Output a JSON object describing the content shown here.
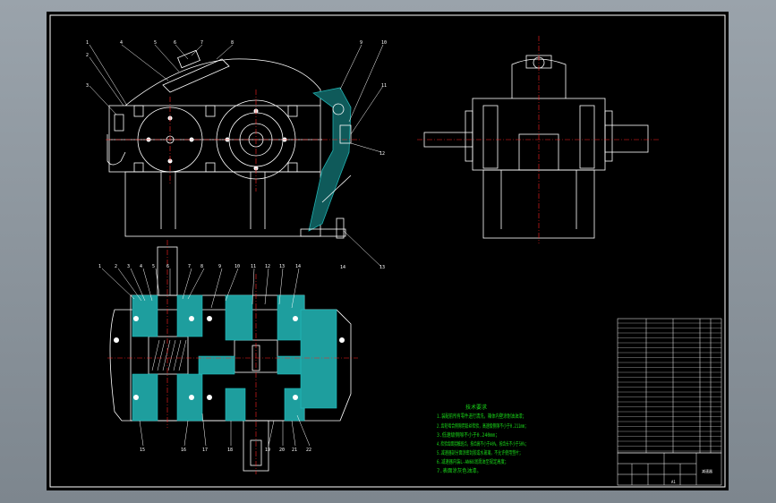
{
  "app": {
    "background_color": "#8a949c",
    "sheet_color": "#000000"
  },
  "drawing": {
    "line_colors": {
      "outline": "#ffffff",
      "centerline": "#ff2020",
      "section_fill": "#20b0b0",
      "notes": "#19d919"
    },
    "callouts_front": [
      "1",
      "2",
      "3",
      "4",
      "5",
      "6",
      "7",
      "8",
      "9",
      "10",
      "11",
      "12",
      "13",
      "14",
      "15",
      "16",
      "17"
    ],
    "callouts_plan_top": [
      "1",
      "2",
      "3",
      "4",
      "5",
      "6",
      "7",
      "8",
      "9",
      "10",
      "11",
      "12",
      "13",
      "14"
    ],
    "callouts_plan_bottom": [
      "15",
      "16",
      "17",
      "18",
      "19",
      "20",
      "21",
      "22"
    ],
    "notes": {
      "title": "技术要求",
      "lines": [
        "1.装配前所有零件进行清洗，箱体内壁涂耐油油漆；",
        "2.齿轮啮合侧隙用铅丝检验，高速级侧隙不小于0.211mm；",
        "3.低速级侧隙不小于0.240mm；",
        "4.检验齿面接触斑点，按齿高不小于40%，按齿长不小于50%；",
        "5.减速器剖分面涂密封胶或水玻璃，不允许使用垫片；",
        "6.减速器内装L-AN68润滑油至规定高度；",
        "7.表面涂灰色油漆。"
      ]
    },
    "title_block": {
      "drawing_name": "减速器",
      "sheet_label": "A1"
    }
  }
}
